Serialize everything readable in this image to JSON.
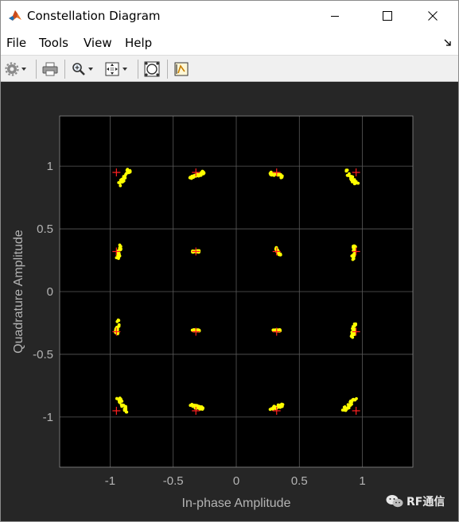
{
  "window": {
    "title": "Constellation Diagram",
    "controls": {
      "minimize": "minimize",
      "maximize": "maximize",
      "close": "close"
    }
  },
  "menu": {
    "items": [
      "File",
      "Tools",
      "View",
      "Help"
    ]
  },
  "toolbar": {
    "buttons": [
      "settings-icon",
      "print-icon",
      "zoom-icon",
      "autoscale-icon",
      "reference-constellation-icon",
      "style-icon"
    ]
  },
  "watermark": {
    "text": "RF通信"
  },
  "colors": {
    "axes_background": "#000000",
    "figure_background": "#262626",
    "received_points": "#ffff00",
    "reference_markers": "#ff2020",
    "grid": "#5a5a5a",
    "axis_text": "#b4b4b4"
  },
  "chart_data": {
    "type": "scatter",
    "title": "",
    "xlabel": "In-phase Amplitude",
    "ylabel": "Quadrature Amplitude",
    "xlim": [
      -1.4,
      1.4
    ],
    "ylim": [
      -1.4,
      1.4
    ],
    "xticks": [
      -1,
      -0.5,
      0,
      0.5,
      1
    ],
    "yticks": [
      1,
      0.5,
      0,
      -0.5,
      -1
    ],
    "xtick_labels": [
      "-1",
      "-0.5",
      "0",
      "0.5",
      "1"
    ],
    "ytick_labels": [
      "1",
      "0.5",
      "0",
      "-0.5",
      "-1"
    ],
    "grid": true,
    "reference_points": [
      [
        -0.95,
        0.95
      ],
      [
        -0.32,
        0.95
      ],
      [
        0.32,
        0.95
      ],
      [
        0.95,
        0.95
      ],
      [
        -0.95,
        0.32
      ],
      [
        -0.32,
        0.32
      ],
      [
        0.32,
        0.32
      ],
      [
        0.95,
        0.32
      ],
      [
        -0.95,
        -0.32
      ],
      [
        -0.32,
        -0.32
      ],
      [
        0.32,
        -0.32
      ],
      [
        0.95,
        -0.32
      ],
      [
        -0.95,
        -0.95
      ],
      [
        -0.32,
        -0.95
      ],
      [
        0.32,
        -0.95
      ],
      [
        0.95,
        -0.95
      ]
    ],
    "received_clusters": [
      {
        "center": [
          -0.89,
          0.91
        ],
        "angle_deg": 55,
        "spread": 0.045
      },
      {
        "center": [
          -0.31,
          0.93
        ],
        "angle_deg": 20,
        "spread": 0.04
      },
      {
        "center": [
          0.32,
          0.93
        ],
        "angle_deg": -15,
        "spread": 0.035
      },
      {
        "center": [
          0.91,
          0.91
        ],
        "angle_deg": -50,
        "spread": 0.045
      },
      {
        "center": [
          -0.93,
          0.32
        ],
        "angle_deg": 80,
        "spread": 0.035
      },
      {
        "center": [
          -0.32,
          0.32
        ],
        "angle_deg": 0,
        "spread": 0.018
      },
      {
        "center": [
          0.33,
          0.32
        ],
        "angle_deg": -60,
        "spread": 0.022
      },
      {
        "center": [
          0.93,
          0.31
        ],
        "angle_deg": 85,
        "spread": 0.035
      },
      {
        "center": [
          -0.94,
          -0.28
        ],
        "angle_deg": 80,
        "spread": 0.035
      },
      {
        "center": [
          -0.32,
          -0.31
        ],
        "angle_deg": 0,
        "spread": 0.018
      },
      {
        "center": [
          0.32,
          -0.31
        ],
        "angle_deg": 0,
        "spread": 0.018
      },
      {
        "center": [
          0.93,
          -0.31
        ],
        "angle_deg": 80,
        "spread": 0.035
      },
      {
        "center": [
          -0.9,
          -0.9
        ],
        "angle_deg": -55,
        "spread": 0.045
      },
      {
        "center": [
          -0.31,
          -0.92
        ],
        "angle_deg": -15,
        "spread": 0.035
      },
      {
        "center": [
          0.32,
          -0.92
        ],
        "angle_deg": 20,
        "spread": 0.035
      },
      {
        "center": [
          0.9,
          -0.9
        ],
        "angle_deg": 45,
        "spread": 0.045
      }
    ]
  }
}
